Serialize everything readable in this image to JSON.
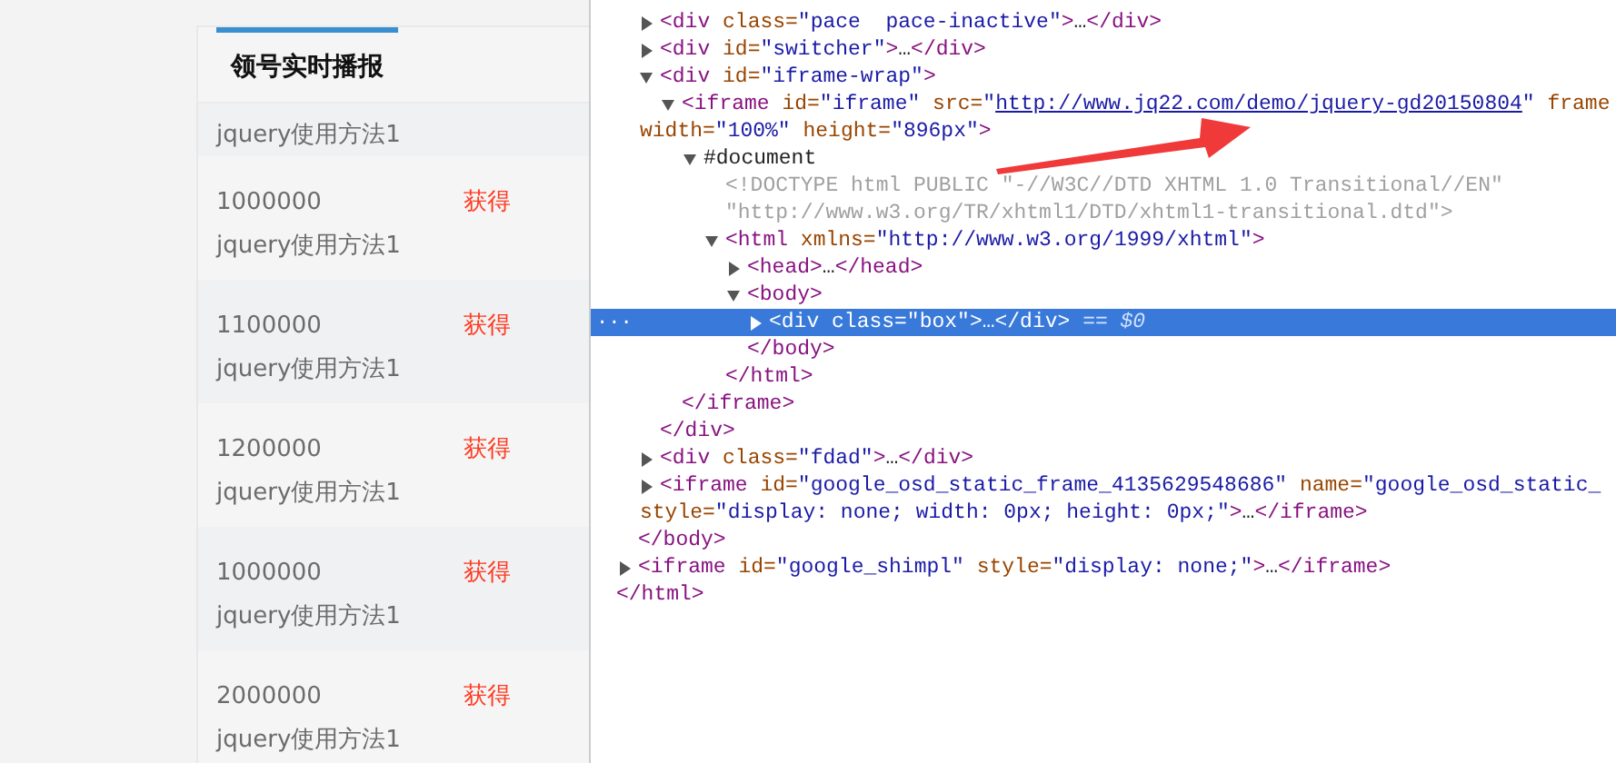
{
  "page": {
    "tab": {
      "label": "领号实时播报",
      "selected": true
    },
    "rows": [
      {
        "title": "jquery使用方法1"
      },
      {
        "amount": "1000000",
        "status": "获得",
        "title": "jquery使用方法1"
      },
      {
        "amount": "1100000",
        "status": "获得",
        "title": "jquery使用方法1"
      },
      {
        "amount": "1200000",
        "status": "获得",
        "title": "jquery使用方法1"
      },
      {
        "amount": "1000000",
        "status": "获得",
        "title": "jquery使用方法1"
      },
      {
        "amount": "2000000",
        "status": "获得",
        "title": "jquery使用方法1"
      }
    ]
  },
  "devtools": {
    "dom": {
      "close": [
        {
          "kind": "tag",
          "text": "</html>"
        }
      ],
      "children": [
        {
          "close": [
            {
              "kind": "tag",
              "text": "</body>"
            }
          ],
          "children": [
            {
              "tokens": [
                {
                  "kind": "tag",
                  "text": "<div"
                },
                {
                  "kind": "attr",
                  "text": " class="
                },
                {
                  "kind": "value",
                  "text": "\"pace  pace-inactive\""
                },
                {
                  "kind": "tag",
                  "text": ">"
                },
                {
                  "kind": "text",
                  "text": "…"
                },
                {
                  "kind": "tag",
                  "text": "</div>"
                }
              ],
              "expanded": false,
              "selected": false
            },
            {
              "tokens": [
                {
                  "kind": "tag",
                  "text": "<div"
                },
                {
                  "kind": "attr",
                  "text": " id="
                },
                {
                  "kind": "value",
                  "text": "\"switcher\""
                },
                {
                  "kind": "tag",
                  "text": ">"
                },
                {
                  "kind": "text",
                  "text": "…"
                },
                {
                  "kind": "tag",
                  "text": "</div>"
                }
              ],
              "expanded": false,
              "selected": false
            },
            {
              "tokens": [
                {
                  "kind": "tag",
                  "text": "<div"
                },
                {
                  "kind": "attr",
                  "text": " id="
                },
                {
                  "kind": "value",
                  "text": "\"iframe-wrap\""
                },
                {
                  "kind": "tag",
                  "text": ">"
                }
              ],
              "expanded": true,
              "selected": false,
              "close": [
                {
                  "kind": "tag",
                  "text": "</div>"
                }
              ],
              "children": [
                {
                  "tokens": [
                    {
                      "kind": "tag",
                      "text": "<iframe"
                    },
                    {
                      "kind": "attr",
                      "text": " id="
                    },
                    {
                      "kind": "value",
                      "text": "\"iframe\""
                    },
                    {
                      "kind": "attr",
                      "text": " src="
                    },
                    {
                      "kind": "value",
                      "text": "\""
                    },
                    {
                      "kind": "link",
                      "text": "http://www.jq22.com/demo/jquery-gd20150804"
                    },
                    {
                      "kind": "value",
                      "text": "\""
                    },
                    {
                      "kind": "attr",
                      "text": " frame"
                    }
                  ],
                  "wrap": [
                    {
                      "kind": "attr",
                      "text": "width="
                    },
                    {
                      "kind": "value",
                      "text": "\"100%\""
                    },
                    {
                      "kind": "attr",
                      "text": " height="
                    },
                    {
                      "kind": "value",
                      "text": "\"896px\""
                    },
                    {
                      "kind": "tag",
                      "text": ">"
                    }
                  ],
                  "expanded": true,
                  "selected": false,
                  "close": [
                    {
                      "kind": "tag",
                      "text": "</iframe>"
                    }
                  ],
                  "children": [
                    {
                      "tokens": [
                        {
                          "kind": "text",
                          "text": "#document"
                        }
                      ],
                      "expanded": true,
                      "selected": false,
                      "children": [
                        {
                          "tokens": [
                            {
                              "kind": "doctype",
                              "text": "<!DOCTYPE html PUBLIC \"-//W3C//DTD XHTML 1.0 Transitional//EN\""
                            }
                          ],
                          "wrap": [
                            {
                              "kind": "doctype",
                              "text": "\"http://www.w3.org/TR/xhtml1/DTD/xhtml1-transitional.dtd\">"
                            }
                          ],
                          "selected": false
                        },
                        {
                          "tokens": [
                            {
                              "kind": "tag",
                              "text": "<html"
                            },
                            {
                              "kind": "attr",
                              "text": " xmlns="
                            },
                            {
                              "kind": "value",
                              "text": "\"http://www.w3.org/1999/xhtml\""
                            },
                            {
                              "kind": "tag",
                              "text": ">"
                            }
                          ],
                          "expanded": true,
                          "selected": false,
                          "close": [
                            {
                              "kind": "tag",
                              "text": "</html>"
                            }
                          ],
                          "children": [
                            {
                              "tokens": [
                                {
                                  "kind": "tag",
                                  "text": "<head>"
                                },
                                {
                                  "kind": "text",
                                  "text": "…"
                                },
                                {
                                  "kind": "tag",
                                  "text": "</head>"
                                }
                              ],
                              "expanded": false,
                              "selected": false
                            },
                            {
                              "tokens": [
                                {
                                  "kind": "tag",
                                  "text": "<body>"
                                }
                              ],
                              "expanded": true,
                              "selected": false,
                              "close": [
                                {
                                  "kind": "tag",
                                  "text": "</body>"
                                }
                              ],
                              "children": [
                                {
                                  "tokens": [
                                    {
                                      "kind": "tag",
                                      "text": "<div"
                                    },
                                    {
                                      "kind": "attr",
                                      "text": " class="
                                    },
                                    {
                                      "kind": "value",
                                      "text": "\"box\""
                                    },
                                    {
                                      "kind": "tag",
                                      "text": ">"
                                    },
                                    {
                                      "kind": "text",
                                      "text": "…"
                                    },
                                    {
                                      "kind": "tag",
                                      "text": "</div>"
                                    },
                                    {
                                      "kind": "console",
                                      "text": " == $0"
                                    }
                                  ],
                                  "expanded": false,
                                  "selected": true,
                                  "marker": "..."
                                }
                              ]
                            }
                          ]
                        }
                      ]
                    }
                  ]
                }
              ]
            },
            {
              "tokens": [
                {
                  "kind": "tag",
                  "text": "<div"
                },
                {
                  "kind": "attr",
                  "text": " class="
                },
                {
                  "kind": "value",
                  "text": "\"fdad\""
                },
                {
                  "kind": "tag",
                  "text": ">"
                },
                {
                  "kind": "text",
                  "text": "…"
                },
                {
                  "kind": "tag",
                  "text": "</div>"
                }
              ],
              "expanded": false,
              "selected": false
            },
            {
              "tokens": [
                {
                  "kind": "tag",
                  "text": "<iframe"
                },
                {
                  "kind": "attr",
                  "text": " id="
                },
                {
                  "kind": "value",
                  "text": "\"google_osd_static_frame_4135629548686\""
                },
                {
                  "kind": "attr",
                  "text": " name="
                },
                {
                  "kind": "value",
                  "text": "\"google_osd_static_"
                }
              ],
              "wrap": [
                {
                  "kind": "attr",
                  "text": "style="
                },
                {
                  "kind": "value",
                  "text": "\"display: none; width: 0px; height: 0px;\""
                },
                {
                  "kind": "tag",
                  "text": ">"
                },
                {
                  "kind": "text",
                  "text": "…"
                },
                {
                  "kind": "tag",
                  "text": "</iframe>"
                }
              ],
              "expanded": false,
              "selected": false
            }
          ]
        },
        {
          "tokens": [
            {
              "kind": "tag",
              "text": "<iframe"
            },
            {
              "kind": "attr",
              "text": " id="
            },
            {
              "kind": "value",
              "text": "\"google_shimpl\""
            },
            {
              "kind": "attr",
              "text": " style="
            },
            {
              "kind": "value",
              "text": "\"display: none;\""
            },
            {
              "kind": "tag",
              "text": ">"
            },
            {
              "kind": "text",
              "text": "…"
            },
            {
              "kind": "tag",
              "text": "</iframe>"
            }
          ],
          "expanded": false,
          "selected": false
        }
      ]
    }
  }
}
